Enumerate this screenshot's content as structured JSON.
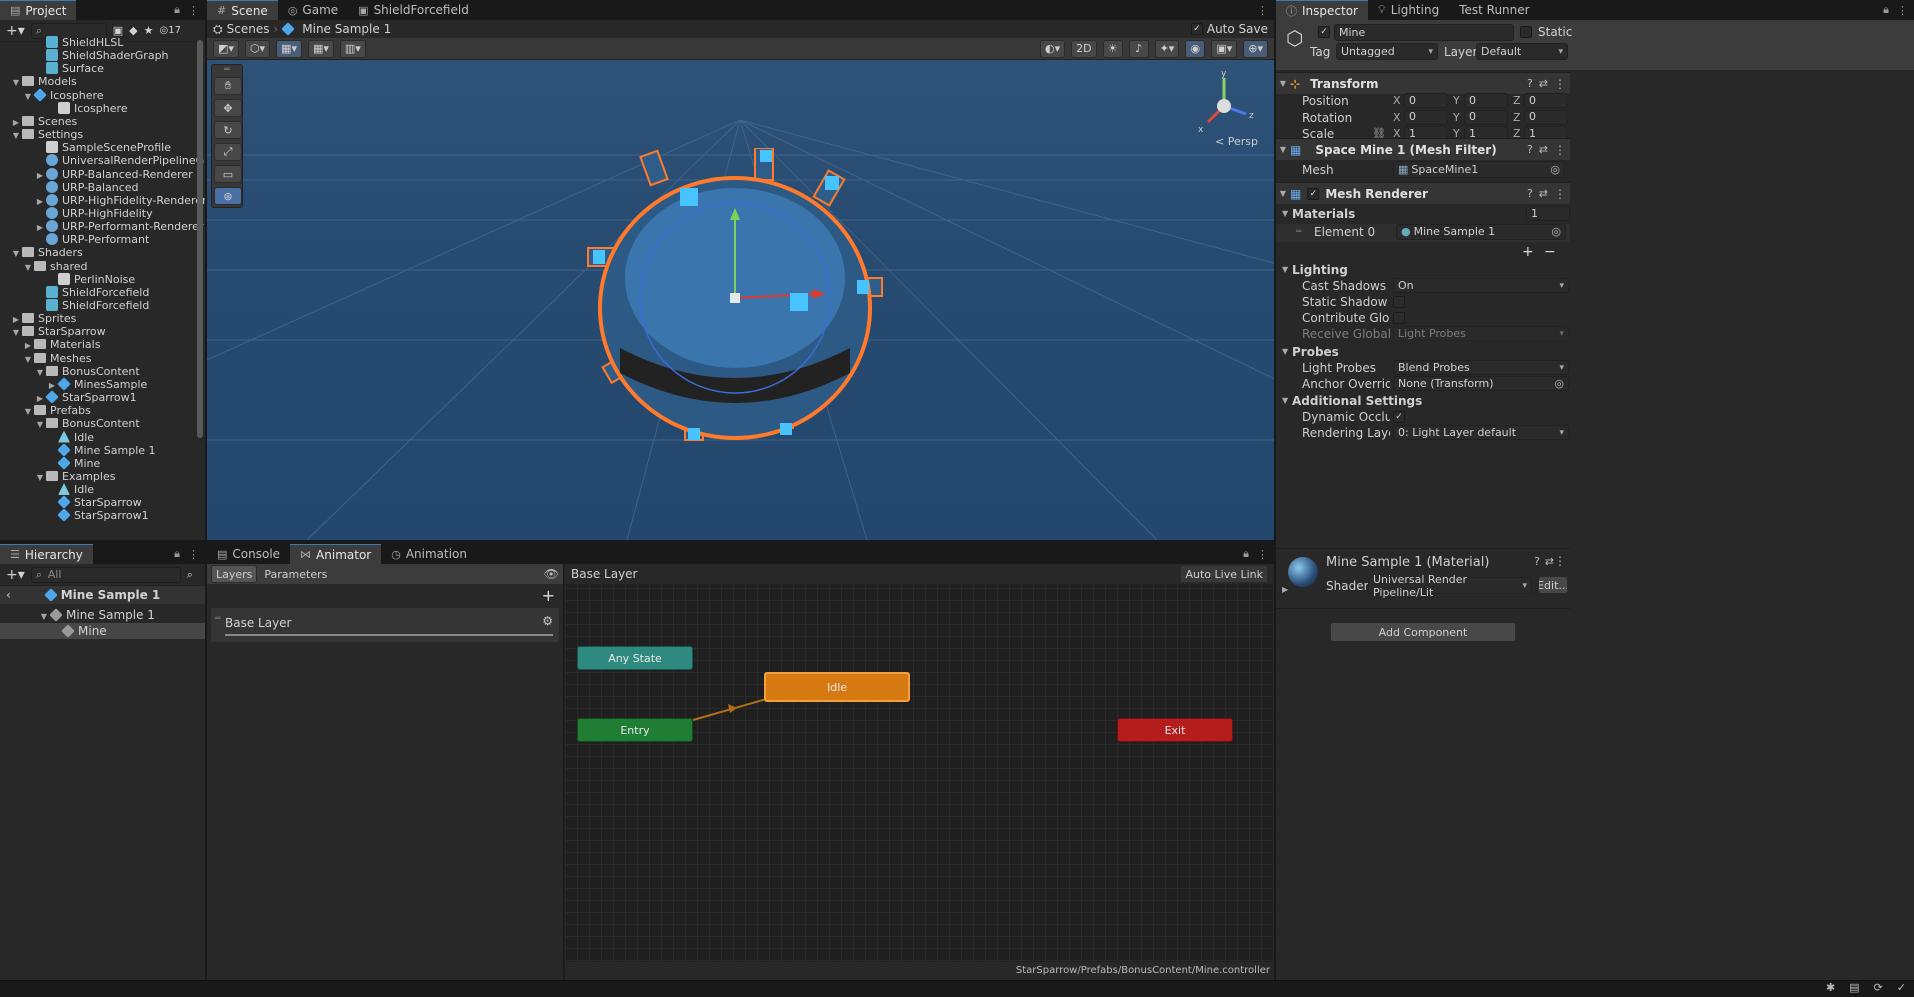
{
  "project": {
    "tab": "Project",
    "count": "17",
    "tree": [
      {
        "label": "ShieldHLSL",
        "icon": "sg",
        "indent": 3,
        "arrow": ""
      },
      {
        "label": "ShieldShaderGraph",
        "icon": "sg",
        "indent": 3,
        "arrow": ""
      },
      {
        "label": "Surface",
        "icon": "sg",
        "indent": 3,
        "arrow": ""
      },
      {
        "label": "Models",
        "icon": "folder",
        "indent": 1,
        "arrow": "▼"
      },
      {
        "label": "Icosphere",
        "icon": "cube",
        "indent": 2,
        "arrow": "▼"
      },
      {
        "label": "Icosphere",
        "icon": "doc",
        "indent": 4,
        "arrow": ""
      },
      {
        "label": "Scenes",
        "icon": "folder",
        "indent": 1,
        "arrow": "▶"
      },
      {
        "label": "Settings",
        "icon": "folder",
        "indent": 1,
        "arrow": "▼"
      },
      {
        "label": "SampleSceneProfile",
        "icon": "doc",
        "indent": 3,
        "arrow": ""
      },
      {
        "label": "UniversalRenderPipelineGlobalS",
        "icon": "rp",
        "indent": 3,
        "arrow": ""
      },
      {
        "label": "URP-Balanced-Renderer",
        "icon": "rp",
        "indent": 3,
        "arrow": "▶"
      },
      {
        "label": "URP-Balanced",
        "icon": "rp",
        "indent": 3,
        "arrow": ""
      },
      {
        "label": "URP-HighFidelity-Renderer",
        "icon": "rp",
        "indent": 3,
        "arrow": "▶"
      },
      {
        "label": "URP-HighFidelity",
        "icon": "rp",
        "indent": 3,
        "arrow": ""
      },
      {
        "label": "URP-Performant-Renderer",
        "icon": "rp",
        "indent": 3,
        "arrow": "▶"
      },
      {
        "label": "URP-Performant",
        "icon": "rp",
        "indent": 3,
        "arrow": ""
      },
      {
        "label": "Shaders",
        "icon": "folder",
        "indent": 1,
        "arrow": "▼"
      },
      {
        "label": "shared",
        "icon": "folder",
        "indent": 2,
        "arrow": "▼"
      },
      {
        "label": "PerlinNoise",
        "icon": "doc",
        "indent": 4,
        "arrow": ""
      },
      {
        "label": "ShieldForcefield",
        "icon": "sg",
        "indent": 3,
        "arrow": ""
      },
      {
        "label": "ShieldForcefield",
        "icon": "sg",
        "indent": 3,
        "arrow": ""
      },
      {
        "label": "Sprites",
        "icon": "folder",
        "indent": 1,
        "arrow": "▶"
      },
      {
        "label": "StarSparrow",
        "icon": "folder",
        "indent": 1,
        "arrow": "▼"
      },
      {
        "label": "Materials",
        "icon": "folder",
        "indent": 2,
        "arrow": "▶"
      },
      {
        "label": "Meshes",
        "icon": "folder",
        "indent": 2,
        "arrow": "▼"
      },
      {
        "label": "BonusContent",
        "icon": "folder",
        "indent": 3,
        "arrow": "▼"
      },
      {
        "label": "MinesSample",
        "icon": "cube",
        "indent": 4,
        "arrow": "▶"
      },
      {
        "label": "StarSparrow1",
        "icon": "cube",
        "indent": 3,
        "arrow": "▶"
      },
      {
        "label": "Prefabs",
        "icon": "folder",
        "indent": 2,
        "arrow": "▼"
      },
      {
        "label": "BonusContent",
        "icon": "folder",
        "indent": 3,
        "arrow": "▼"
      },
      {
        "label": "Idle",
        "icon": "anim",
        "indent": 4,
        "arrow": ""
      },
      {
        "label": "Mine Sample 1",
        "icon": "cube",
        "indent": 4,
        "arrow": ""
      },
      {
        "label": "Mine",
        "icon": "cube",
        "indent": 4,
        "arrow": ""
      },
      {
        "label": "Examples",
        "icon": "folder",
        "indent": 3,
        "arrow": "▼"
      },
      {
        "label": "Idle",
        "icon": "anim",
        "indent": 4,
        "arrow": ""
      },
      {
        "label": "StarSparrow",
        "icon": "cube",
        "indent": 4,
        "arrow": ""
      },
      {
        "label": "StarSparrow1",
        "icon": "cube",
        "indent": 4,
        "arrow": ""
      }
    ]
  },
  "hierarchy": {
    "tab": "Hierarchy",
    "search_placeholder": "All",
    "root": "Mine Sample 1",
    "items": [
      "Mine Sample 1",
      "Mine"
    ]
  },
  "scene": {
    "tabs": [
      "Scene",
      "Game",
      "ShieldForcefield"
    ],
    "breadcrumb_root": "Scenes",
    "breadcrumb_item": "Mine Sample 1",
    "auto_save": "Auto Save",
    "mode_2d": "2D",
    "persp": "< Persp"
  },
  "bottom": {
    "tabs": [
      "Console",
      "Animator",
      "Animation"
    ],
    "subtabs": [
      "Layers",
      "Parameters"
    ],
    "layer_name": "Base Layer",
    "breadcrumb": "Base Layer",
    "auto_live_link": "Auto Live Link",
    "path": "StarSparrow/Prefabs/BonusContent/Mine.controller",
    "states": {
      "any": "Any State",
      "idle": "Idle",
      "entry": "Entry",
      "exit": "Exit"
    },
    "colors": {
      "any": "#2e8a7e",
      "idle": "#d87a12",
      "entry": "#1f7e34",
      "exit": "#b51d1d"
    }
  },
  "inspector": {
    "tabs": [
      "Inspector",
      "Lighting",
      "Test Runner"
    ],
    "object_name": "Mine",
    "static_label": "Static",
    "tag_label": "Tag",
    "tag_value": "Untagged",
    "layer_label": "Layer",
    "layer_value": "Default",
    "transform": {
      "title": "Transform",
      "position": {
        "label": "Position",
        "x": "0",
        "y": "0",
        "z": "0"
      },
      "rotation": {
        "label": "Rotation",
        "x": "0",
        "y": "0",
        "z": "0"
      },
      "scale": {
        "label": "Scale",
        "x": "1",
        "y": "1",
        "z": "1"
      }
    },
    "mesh_filter": {
      "title": "Space Mine 1 (Mesh Filter)",
      "mesh_label": "Mesh",
      "mesh_value": "SpaceMine1"
    },
    "mesh_renderer": {
      "title": "Mesh Renderer",
      "materials_label": "Materials",
      "materials_count": "1",
      "element_label": "Element 0",
      "element_value": "Mine Sample 1",
      "lighting_label": "Lighting",
      "cast_shadows_label": "Cast Shadows",
      "cast_shadows_value": "On",
      "static_shadow_label": "Static Shadow Cas",
      "contribute_gi_label": "Contribute Global Il",
      "receive_gi_label": "Receive Global Illur",
      "receive_gi_value": "Light Probes",
      "probes_label": "Probes",
      "light_probes_label": "Light Probes",
      "light_probes_value": "Blend Probes",
      "anchor_label": "Anchor Override",
      "anchor_value": "None (Transform)",
      "additional_label": "Additional Settings",
      "dynamic_occ_label": "Dynamic Occlusion",
      "rendering_layer_label": "Rendering Layer M",
      "rendering_layer_value": "0: Light Layer default"
    },
    "material": {
      "title": "Mine Sample 1 (Material)",
      "shader_label": "Shader",
      "shader_value": "Universal Render Pipeline/Lit",
      "edit": "Edit..."
    },
    "add_component": "Add Component"
  }
}
